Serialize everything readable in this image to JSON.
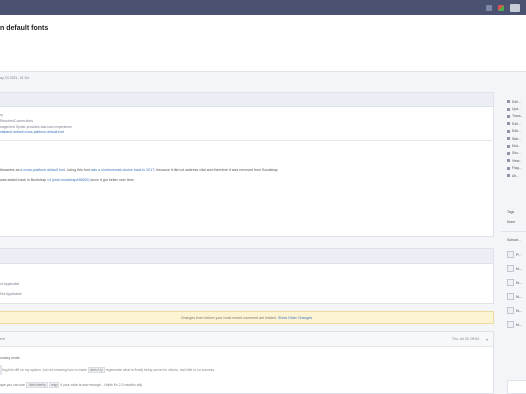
{
  "topbar": {
    "icons": [
      "notifications-icon",
      "apps-icon",
      "user-avatar"
    ]
  },
  "page": {
    "title": "n default fonts",
    "date": "ay 23 2021, 01:04"
  },
  "meta": {
    "line1": "ry",
    "line2": "ResolvedConnections",
    "line3": "eagerized Spider-provides-bad-user-experience",
    "line4_link": "stabasic default cross-platform-default-font"
  },
  "description": {
    "line1_a": "ttmawers as ",
    "line1_link1": "a cross-platform default font",
    "line1_b": ". Using this font ",
    "line1_link2": "was a controversial choice back in 2017",
    "line1_c": ", because it did not address vital and therefore it was removed from Bootstrap",
    "line2_a": " was added back in Bootstrap ",
    "line2_link": "v4 (redo bootstrap#38900)",
    "line2_b": " since it got better over time."
  },
  "panel2": {
    "line1": "ot Applicable",
    "line2": "Not Applicable"
  },
  "notice": {
    "text": "Changes from before your most recent comment are hidden. ",
    "link": "Show Older Changes"
  },
  "comment": {
    "author": "ent",
    "date": "Thu, Jul 29, 09:54",
    "caret": "▾",
    "wrote": "rodaxy wrote:",
    "quote_a": "ting this diff on my system, but not knowing how to make ",
    "quote_code": "detect-fy",
    "quote_b": " regenerate what is finally being served to clients, had little to no success.",
    "reply_a": "ape you can use ",
    "reply_code1": "./bin/celerity",
    "reply_code2": "map",
    "reply_b": " if your code is new enough - I think it's 2-3 months old)"
  },
  "sidebar": {
    "items": [
      "Edit...",
      "Upd...",
      "Trans...",
      "Edit...",
      "Edit...",
      "Wat...",
      "Mut...",
      "Sho...",
      "View...",
      "Flag...",
      "Alt..."
    ],
    "tags_label": "Tags",
    "tags_value": "None",
    "subscribers_label": "Subscri...",
    "subscribers": [
      "P...",
      "N...",
      "N...",
      "N...",
      "N...",
      "N..."
    ]
  },
  "colors": {
    "topbar": "#4a5171",
    "link": "#3b73b9",
    "notice_bg": "#fdf4d4",
    "icon_red": "#d9534f",
    "icon_green": "#4caf50"
  }
}
